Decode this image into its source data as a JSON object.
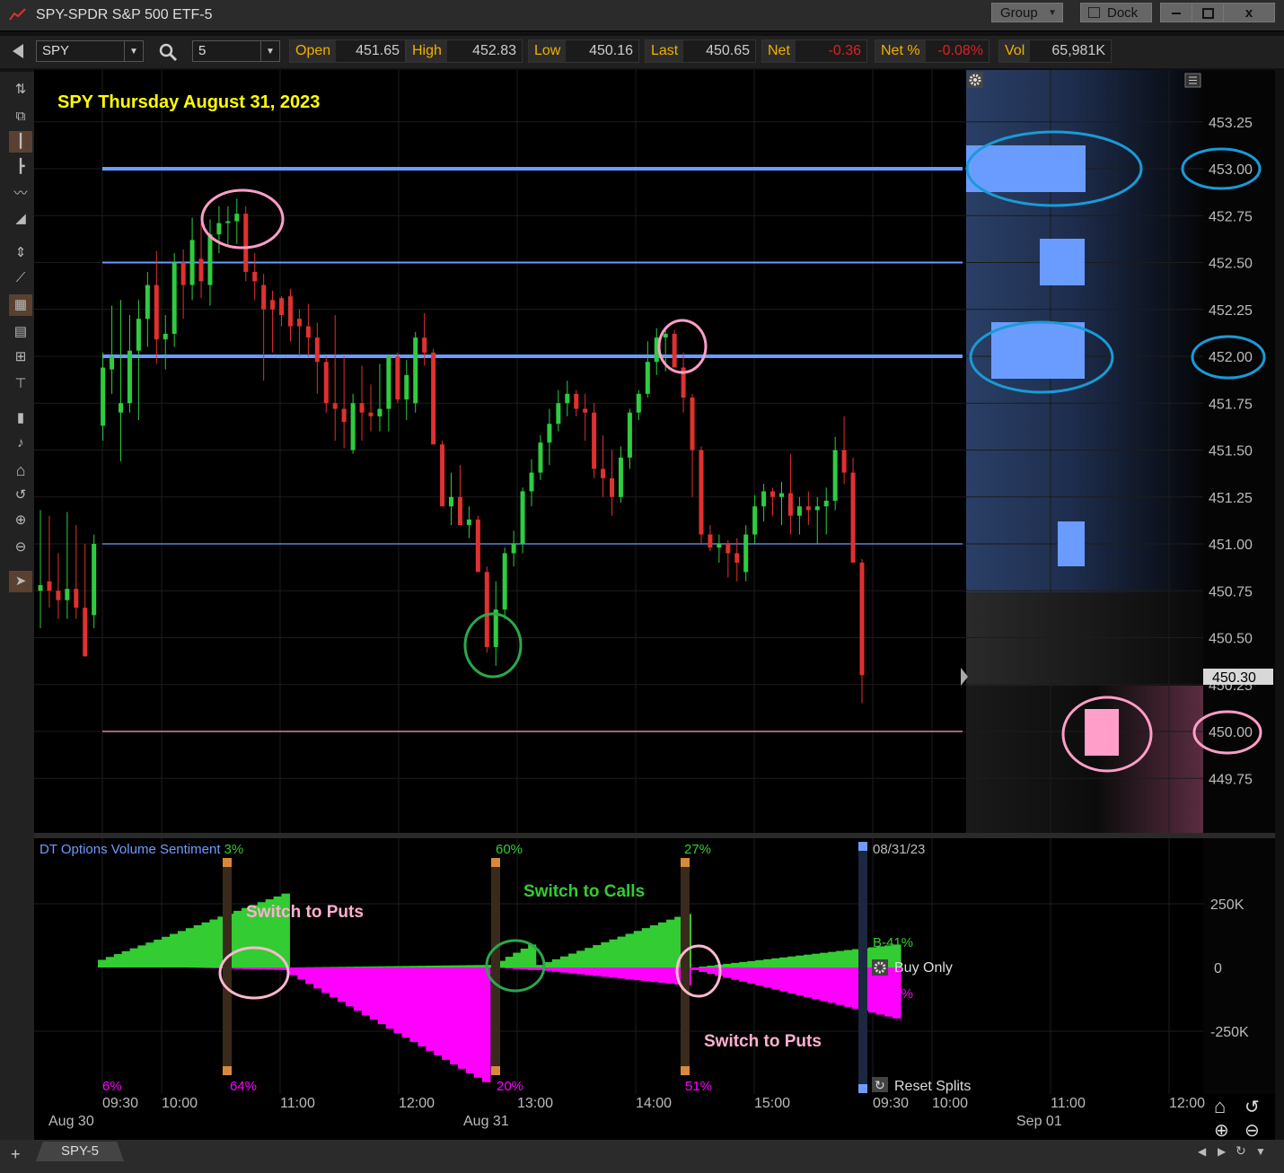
{
  "window": {
    "title": "SPY-SPDR S&P 500 ETF-5",
    "group_label": "Group",
    "dock_label": "Dock",
    "close_label": "x"
  },
  "toolbar": {
    "symbol": "SPY",
    "interval": "5",
    "quote": {
      "open_label": "Open",
      "open": "451.65",
      "high_label": "High",
      "high": "452.83",
      "low_label": "Low",
      "low": "450.16",
      "last_label": "Last",
      "last": "450.65",
      "net_label": "Net",
      "net": "-0.36",
      "netpct_label": "Net %",
      "netpct": "-0.08%",
      "vol_label": "Vol",
      "vol": "65,981K"
    }
  },
  "chart": {
    "annotation_title": "SPY Thursday August 31, 2023",
    "price_tick_labels": [
      "453.25",
      "453.00",
      "452.75",
      "452.50",
      "452.25",
      "452.00",
      "451.75",
      "451.50",
      "451.25",
      "451.00",
      "450.75",
      "450.50",
      "450.25",
      "450.00",
      "449.75"
    ],
    "current_price_label": "450.30",
    "circled_levels": [
      "453.00",
      "452.00",
      "450.00"
    ]
  },
  "indicator": {
    "title": "DT Options Volume Sentiment",
    "date_label": "08/31/23",
    "y_labels": [
      "250K",
      "0",
      "-250K"
    ],
    "b_calls": "B-41%",
    "b_puts": "B-39%",
    "mode": "Buy Only",
    "reset_label": "Reset Splits",
    "switch_labels": {
      "puts1": "Switch to Puts",
      "calls": "Switch to Calls",
      "puts2": "Switch to Puts"
    },
    "split_pct": [
      {
        "top": "3%",
        "bottom": "64%"
      },
      {
        "top": "60%",
        "bottom": "20%"
      },
      {
        "top": "27%",
        "bottom": "51%"
      }
    ],
    "start_bottom_pct": "6%"
  },
  "time_axis": {
    "times": [
      "09:30",
      "10:00",
      "11:00",
      "12:00",
      "13:00",
      "14:00",
      "15:00",
      "09:30",
      "10:00",
      "11:00",
      "12:00"
    ],
    "dates": [
      "Aug 30",
      "Aug 31",
      "Sep 01"
    ]
  },
  "bottom": {
    "tab_label": "SPY-5"
  },
  "colors": {
    "up": "#2ecc40",
    "down": "#e03030",
    "level_line": "#6a9cff",
    "pink": "#ff9ec8",
    "calls_fill": "#33cc33",
    "puts_fill": "#ff00ff",
    "cyan_circle": "#1a9ad6",
    "title_yellow": "#ffff00"
  },
  "chart_data": {
    "type": "candlestick",
    "title": "SPY Thursday August 31, 2023",
    "ylim": [
      449.6,
      453.45
    ],
    "levels": [
      453.0,
      452.5,
      452.0,
      451.0,
      450.0
    ],
    "candles": [
      {
        "o": 450.75,
        "h": 451.18,
        "l": 450.55,
        "c": 450.78
      },
      {
        "o": 450.8,
        "h": 451.15,
        "l": 450.66,
        "c": 450.75
      },
      {
        "o": 450.75,
        "h": 450.95,
        "l": 450.6,
        "c": 450.7
      },
      {
        "o": 450.7,
        "h": 451.17,
        "l": 450.6,
        "c": 450.76
      },
      {
        "o": 450.76,
        "h": 451.1,
        "l": 450.6,
        "c": 450.66
      },
      {
        "o": 450.66,
        "h": 451.0,
        "l": 450.52,
        "c": 450.4
      },
      {
        "o": 450.62,
        "h": 451.05,
        "l": 450.55,
        "c": 451.0
      },
      {
        "o": 451.63,
        "h": 452.02,
        "l": 451.55,
        "c": 451.94
      },
      {
        "o": 451.93,
        "h": 452.27,
        "l": 451.8,
        "c": 452.0
      },
      {
        "o": 451.7,
        "h": 452.3,
        "l": 451.44,
        "c": 451.75
      },
      {
        "o": 451.75,
        "h": 452.22,
        "l": 451.7,
        "c": 452.03
      },
      {
        "o": 452.03,
        "h": 452.3,
        "l": 451.66,
        "c": 452.2
      },
      {
        "o": 452.2,
        "h": 452.45,
        "l": 452.05,
        "c": 452.38
      },
      {
        "o": 452.38,
        "h": 452.56,
        "l": 451.96,
        "c": 452.09
      },
      {
        "o": 452.09,
        "h": 452.22,
        "l": 451.93,
        "c": 452.12
      },
      {
        "o": 452.12,
        "h": 452.55,
        "l": 452.05,
        "c": 452.5
      },
      {
        "o": 452.5,
        "h": 452.57,
        "l": 452.2,
        "c": 452.38
      },
      {
        "o": 452.38,
        "h": 452.74,
        "l": 452.3,
        "c": 452.62
      },
      {
        "o": 452.52,
        "h": 452.71,
        "l": 452.31,
        "c": 452.4
      },
      {
        "o": 452.38,
        "h": 452.73,
        "l": 452.27,
        "c": 452.65
      },
      {
        "o": 452.65,
        "h": 452.8,
        "l": 452.55,
        "c": 452.71
      },
      {
        "o": 452.71,
        "h": 452.8,
        "l": 452.59,
        "c": 452.72
      },
      {
        "o": 452.72,
        "h": 452.84,
        "l": 452.6,
        "c": 452.76
      },
      {
        "o": 452.76,
        "h": 452.8,
        "l": 452.4,
        "c": 452.45
      },
      {
        "o": 452.45,
        "h": 452.55,
        "l": 452.3,
        "c": 452.4
      },
      {
        "o": 452.38,
        "h": 452.44,
        "l": 451.87,
        "c": 452.25
      },
      {
        "o": 452.3,
        "h": 452.35,
        "l": 452.02,
        "c": 452.25
      },
      {
        "o": 452.31,
        "h": 452.32,
        "l": 452.16,
        "c": 452.22
      },
      {
        "o": 452.32,
        "h": 452.36,
        "l": 452.08,
        "c": 452.16
      },
      {
        "o": 452.2,
        "h": 452.25,
        "l": 452.0,
        "c": 452.16
      },
      {
        "o": 452.16,
        "h": 452.28,
        "l": 452.0,
        "c": 452.1
      },
      {
        "o": 452.1,
        "h": 452.18,
        "l": 451.8,
        "c": 451.97
      },
      {
        "o": 451.97,
        "h": 452.0,
        "l": 451.7,
        "c": 451.75
      },
      {
        "o": 451.75,
        "h": 452.22,
        "l": 451.55,
        "c": 451.72
      },
      {
        "o": 451.72,
        "h": 452.0,
        "l": 451.51,
        "c": 451.65
      },
      {
        "o": 451.5,
        "h": 451.8,
        "l": 451.48,
        "c": 451.75
      },
      {
        "o": 451.75,
        "h": 451.95,
        "l": 451.55,
        "c": 451.7
      },
      {
        "o": 451.7,
        "h": 451.85,
        "l": 451.6,
        "c": 451.68
      },
      {
        "o": 451.68,
        "h": 451.96,
        "l": 451.6,
        "c": 451.72
      },
      {
        "o": 451.72,
        "h": 452.0,
        "l": 451.6,
        "c": 452.0
      },
      {
        "o": 452.0,
        "h": 452.02,
        "l": 451.75,
        "c": 451.77
      },
      {
        "o": 451.77,
        "h": 451.98,
        "l": 451.66,
        "c": 451.9
      },
      {
        "o": 451.75,
        "h": 452.13,
        "l": 451.7,
        "c": 452.1
      },
      {
        "o": 452.1,
        "h": 452.23,
        "l": 451.95,
        "c": 452.02
      },
      {
        "o": 452.02,
        "h": 452.04,
        "l": 451.6,
        "c": 451.53
      },
      {
        "o": 451.53,
        "h": 451.55,
        "l": 451.26,
        "c": 451.2
      },
      {
        "o": 451.2,
        "h": 451.38,
        "l": 451.1,
        "c": 451.25
      },
      {
        "o": 451.25,
        "h": 451.42,
        "l": 451.12,
        "c": 451.1
      },
      {
        "o": 451.1,
        "h": 451.2,
        "l": 451.03,
        "c": 451.13
      },
      {
        "o": 451.13,
        "h": 451.15,
        "l": 450.85,
        "c": 450.85
      },
      {
        "o": 450.85,
        "h": 450.88,
        "l": 450.42,
        "c": 450.45
      },
      {
        "o": 450.45,
        "h": 450.8,
        "l": 450.35,
        "c": 450.65
      },
      {
        "o": 450.65,
        "h": 450.98,
        "l": 450.6,
        "c": 450.95
      },
      {
        "o": 450.95,
        "h": 451.07,
        "l": 450.88,
        "c": 451.0
      },
      {
        "o": 451.0,
        "h": 451.3,
        "l": 450.95,
        "c": 451.28
      },
      {
        "o": 451.28,
        "h": 451.45,
        "l": 451.2,
        "c": 451.38
      },
      {
        "o": 451.38,
        "h": 451.58,
        "l": 451.34,
        "c": 451.54
      },
      {
        "o": 451.54,
        "h": 451.72,
        "l": 451.42,
        "c": 451.64
      },
      {
        "o": 451.64,
        "h": 451.82,
        "l": 451.6,
        "c": 451.75
      },
      {
        "o": 451.75,
        "h": 451.87,
        "l": 451.68,
        "c": 451.8
      },
      {
        "o": 451.8,
        "h": 451.82,
        "l": 451.68,
        "c": 451.72
      },
      {
        "o": 451.72,
        "h": 451.8,
        "l": 451.55,
        "c": 451.7
      },
      {
        "o": 451.7,
        "h": 451.75,
        "l": 451.35,
        "c": 451.4
      },
      {
        "o": 451.4,
        "h": 451.58,
        "l": 451.25,
        "c": 451.35
      },
      {
        "o": 451.35,
        "h": 451.5,
        "l": 451.15,
        "c": 451.25
      },
      {
        "o": 451.25,
        "h": 451.52,
        "l": 451.22,
        "c": 451.46
      },
      {
        "o": 451.46,
        "h": 451.72,
        "l": 451.4,
        "c": 451.7
      },
      {
        "o": 451.7,
        "h": 451.82,
        "l": 451.66,
        "c": 451.8
      },
      {
        "o": 451.8,
        "h": 452.08,
        "l": 451.78,
        "c": 451.97
      },
      {
        "o": 451.97,
        "h": 452.15,
        "l": 451.9,
        "c": 452.1
      },
      {
        "o": 452.1,
        "h": 452.14,
        "l": 451.92,
        "c": 452.12
      },
      {
        "o": 452.12,
        "h": 452.14,
        "l": 451.96,
        "c": 451.94
      },
      {
        "o": 451.94,
        "h": 452.02,
        "l": 451.7,
        "c": 451.78
      },
      {
        "o": 451.78,
        "h": 451.8,
        "l": 451.25,
        "c": 451.5
      },
      {
        "o": 451.5,
        "h": 451.52,
        "l": 451.0,
        "c": 451.05
      },
      {
        "o": 451.05,
        "h": 451.1,
        "l": 450.96,
        "c": 450.98
      },
      {
        "o": 450.98,
        "h": 451.05,
        "l": 450.9,
        "c": 451.0
      },
      {
        "o": 451.0,
        "h": 451.02,
        "l": 450.82,
        "c": 450.95
      },
      {
        "o": 450.95,
        "h": 451.03,
        "l": 450.8,
        "c": 450.9
      },
      {
        "o": 450.85,
        "h": 451.1,
        "l": 450.8,
        "c": 451.05
      },
      {
        "o": 451.05,
        "h": 451.26,
        "l": 451.0,
        "c": 451.2
      },
      {
        "o": 451.2,
        "h": 451.32,
        "l": 451.12,
        "c": 451.28
      },
      {
        "o": 451.28,
        "h": 451.3,
        "l": 451.15,
        "c": 451.25
      },
      {
        "o": 451.25,
        "h": 451.33,
        "l": 451.1,
        "c": 451.27
      },
      {
        "o": 451.27,
        "h": 451.48,
        "l": 451.05,
        "c": 451.15
      },
      {
        "o": 451.15,
        "h": 451.25,
        "l": 451.05,
        "c": 451.2
      },
      {
        "o": 451.2,
        "h": 451.28,
        "l": 451.1,
        "c": 451.18
      },
      {
        "o": 451.18,
        "h": 451.25,
        "l": 451.0,
        "c": 451.2
      },
      {
        "o": 451.2,
        "h": 451.3,
        "l": 451.05,
        "c": 451.23
      },
      {
        "o": 451.23,
        "h": 451.57,
        "l": 451.18,
        "c": 451.5
      },
      {
        "o": 451.5,
        "h": 451.68,
        "l": 451.32,
        "c": 451.38
      },
      {
        "o": 451.38,
        "h": 451.46,
        "l": 450.95,
        "c": 450.9
      },
      {
        "o": 450.9,
        "h": 450.92,
        "l": 450.15,
        "c": 450.3
      }
    ],
    "sentiment": {
      "calls_segments": [
        {
          "from": 0.05,
          "to": 0.26,
          "start": 30000,
          "end": 290000
        },
        {
          "from": 0.26,
          "to": 0.48,
          "start": 0,
          "end": 10000
        },
        {
          "from": 0.48,
          "to": 0.53,
          "start": 10000,
          "end": 90000
        },
        {
          "from": 0.53,
          "to": 0.7,
          "start": 10000,
          "end": 210000
        },
        {
          "from": 0.7,
          "to": 0.93,
          "start": 0,
          "end": 90000
        }
      ],
      "puts_segments": [
        {
          "from": 0.14,
          "to": 0.26,
          "start": 0,
          "end": -10000
        },
        {
          "from": 0.26,
          "to": 0.48,
          "start": -30000,
          "end": -450000
        },
        {
          "from": 0.48,
          "to": 0.53,
          "start": 0,
          "end": -10000
        },
        {
          "from": 0.53,
          "to": 0.7,
          "start": -10000,
          "end": -70000
        },
        {
          "from": 0.7,
          "to": 0.93,
          "start": -10000,
          "end": -200000
        }
      ]
    }
  }
}
